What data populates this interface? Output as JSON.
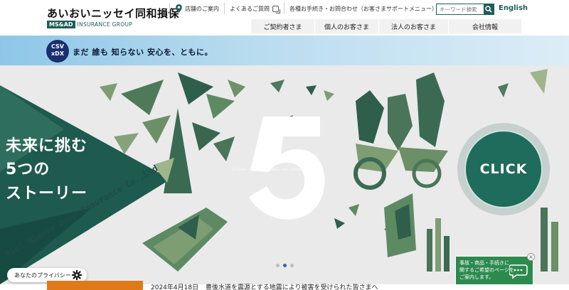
{
  "brand": {
    "name_jp": "あいおいニッセイ同和損保",
    "ms_ad": "MS&AD",
    "group": "INSURANCE GROUP"
  },
  "utility": {
    "stores_label": "店舗のご案内",
    "faq_label": "よくあるご質問",
    "procedures_label": "各種お手続き・お問合わせ（お客さまサポートメニュー）",
    "search_placeholder": "キーワード検索",
    "english_label": "English"
  },
  "nav": {
    "items": [
      "ご契約者さま",
      "個人のお客さま",
      "法人のお客さま",
      "会社情報"
    ]
  },
  "banner": {
    "badge_top": "CSV",
    "badge_bottom": "xDX",
    "text": "まだ 誰も 知らない 安心を、ともに。"
  },
  "hero": {
    "title_line1": "未来に挑む",
    "title_line2": "5つの",
    "title_line3": "ストーリー",
    "big_number": "5",
    "stories_caption": "STORIES THAT CHALLENGE THE FUTURE",
    "diagonal_text": "Aioi Nissay Dowa Insurance Co.,Ltd",
    "click_label": "CLICK",
    "slide_count": 3,
    "active_slide": 2
  },
  "privacy": {
    "label": "あなたのプライバシー"
  },
  "consult": {
    "line1": "事故・商品・手続きに",
    "line2": "関するご希望のページを",
    "line3": "ご案内します。",
    "close": "×"
  },
  "news": {
    "date": "2024年4月18日",
    "text": "豊後水道を震源とする地震により被害を受けられた皆さまへ"
  },
  "colors": {
    "brand_green": "#1f5c56",
    "click_green": "#1f6b5c",
    "consult_green": "#2d8a4f",
    "banner_blue": "#8fc6e8",
    "news_orange": "#e07a18",
    "active_dot": "#2a67b8"
  },
  "icons": [
    "map-pin-icon",
    "external-window-icon",
    "search-icon",
    "gear-icon",
    "chat-bubble-icon"
  ]
}
